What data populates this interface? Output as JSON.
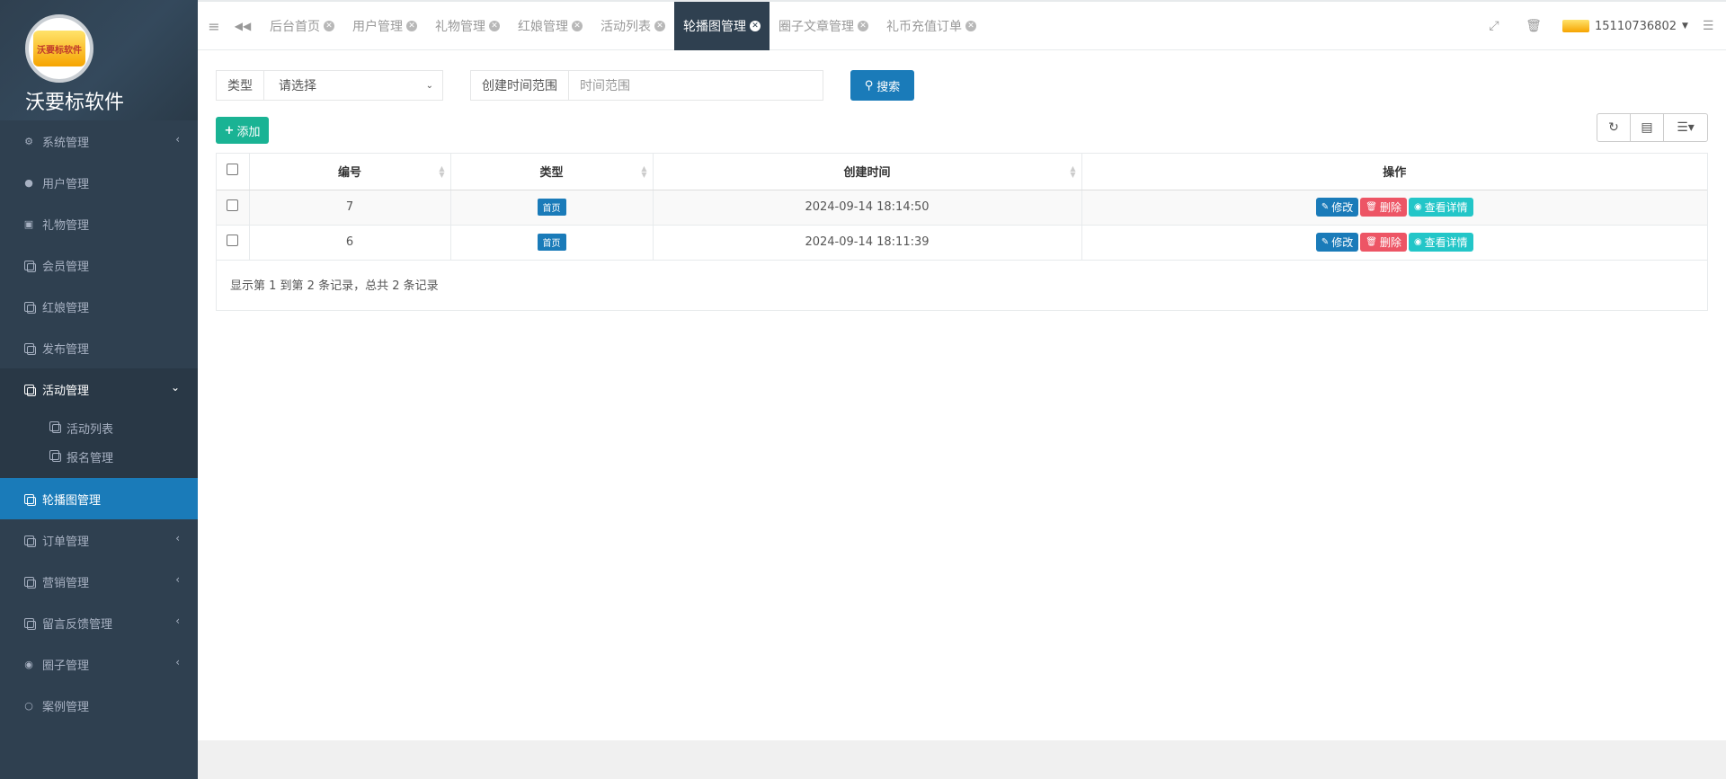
{
  "brand": {
    "logo_text": "沃要标软件",
    "title": "沃要标软件"
  },
  "sidebar": {
    "items": [
      {
        "label": "系统管理",
        "arrow": "‹"
      },
      {
        "label": "用户管理"
      },
      {
        "label": "礼物管理"
      },
      {
        "label": "会员管理"
      },
      {
        "label": "红娘管理"
      },
      {
        "label": "发布管理"
      },
      {
        "label": "活动管理",
        "arrow": "⌄"
      },
      {
        "label": "轮播图管理"
      },
      {
        "label": "订单管理",
        "arrow": "‹"
      },
      {
        "label": "营销管理",
        "arrow": "‹"
      },
      {
        "label": "留言反馈管理",
        "arrow": "‹"
      },
      {
        "label": "圈子管理",
        "arrow": "‹"
      },
      {
        "label": "案例管理"
      }
    ],
    "sub_items": [
      {
        "label": "活动列表"
      },
      {
        "label": "报名管理"
      }
    ]
  },
  "tabs": [
    {
      "label": "后台首页"
    },
    {
      "label": "用户管理"
    },
    {
      "label": "礼物管理"
    },
    {
      "label": "红娘管理"
    },
    {
      "label": "活动列表"
    },
    {
      "label": "轮播图管理"
    },
    {
      "label": "圈子文章管理"
    },
    {
      "label": "礼币充值订单"
    }
  ],
  "header": {
    "username": "15110736802"
  },
  "search": {
    "type_label": "类型",
    "type_value": "请选择",
    "time_label": "创建时间范围",
    "time_placeholder": "时间范围",
    "search_button": "搜索"
  },
  "toolbar": {
    "add_button": "添加"
  },
  "table": {
    "columns": [
      "编号",
      "类型",
      "创建时间",
      "操作"
    ],
    "rows": [
      {
        "id": "7",
        "type": "首页",
        "created": "2024-09-14 18:14:50"
      },
      {
        "id": "6",
        "type": "首页",
        "created": "2024-09-14 18:11:39"
      }
    ],
    "actions": {
      "edit": "修改",
      "delete": "删除",
      "view": "查看详情"
    },
    "summary": "显示第 1 到第 2 条记录，总共 2 条记录"
  },
  "colors": {
    "sidebar_bg": "#2f4050",
    "primary": "#1a7bb9",
    "success": "#1ab394",
    "danger": "#ed5565",
    "info": "#23c6c8"
  }
}
